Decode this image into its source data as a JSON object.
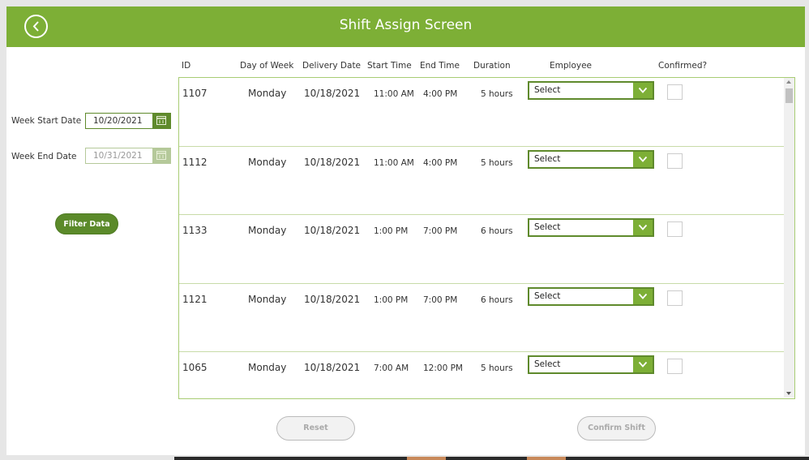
{
  "header": {
    "title": "Shift Assign Screen",
    "back_icon": "chevron-left-circle-icon"
  },
  "filters": {
    "week_start_label": "Week Start Date",
    "week_start_value": "10/20/2021",
    "week_end_label": "Week End Date",
    "week_end_value": "10/31/2021",
    "calendar_icon": "calendar-icon",
    "filter_button": "Filter Data"
  },
  "table": {
    "columns": [
      "ID",
      "Day of Week",
      "Delivery Date",
      "Start Time",
      "End Time",
      "Duration",
      "Employee",
      "Confirmed?"
    ],
    "rows": [
      {
        "id": "1107",
        "day": "Monday",
        "date": "10/18/2021",
        "start": "11:00 AM",
        "end": "4:00 PM",
        "duration": "5 hours",
        "employee": "Select",
        "confirmed": false
      },
      {
        "id": "1112",
        "day": "Monday",
        "date": "10/18/2021",
        "start": "11:00 AM",
        "end": "4:00 PM",
        "duration": "5 hours",
        "employee": "Select",
        "confirmed": false
      },
      {
        "id": "1133",
        "day": "Monday",
        "date": "10/18/2021",
        "start": "1:00 PM",
        "end": "7:00 PM",
        "duration": "6 hours",
        "employee": "Select",
        "confirmed": false
      },
      {
        "id": "1121",
        "day": "Monday",
        "date": "10/18/2021",
        "start": "1:00 PM",
        "end": "7:00 PM",
        "duration": "6 hours",
        "employee": "Select",
        "confirmed": false
      },
      {
        "id": "1065",
        "day": "Monday",
        "date": "10/18/2021",
        "start": "7:00 AM",
        "end": "12:00 PM",
        "duration": "5 hours",
        "employee": "Select",
        "confirmed": false
      }
    ]
  },
  "actions": {
    "reset": "Reset",
    "confirm": "Confirm Shift"
  },
  "colors": {
    "brand": "#7daf36",
    "brand_dark": "#5b8a2a",
    "gallery_border": "#a8cc74"
  }
}
